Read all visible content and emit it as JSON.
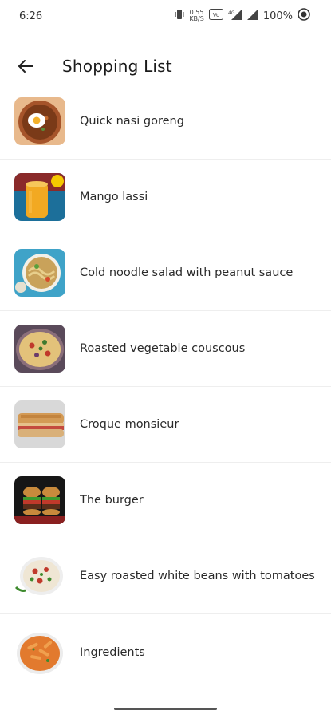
{
  "status_bar": {
    "time": "6:26",
    "net_speed_top": "0.55",
    "net_speed_bottom": "KB/S",
    "battery_percent": "100%",
    "icons": [
      "vibrate-icon",
      "network-speed-icon",
      "volte-icon",
      "signal-4g-icon",
      "signal-icon",
      "battery-icon",
      "record-icon"
    ]
  },
  "app_bar": {
    "title": "Shopping List",
    "back_icon": "arrow-left-icon"
  },
  "items": [
    {
      "label": "Quick nasi goreng"
    },
    {
      "label": "Mango lassi"
    },
    {
      "label": "Cold noodle salad with peanut sauce"
    },
    {
      "label": "Roasted vegetable couscous"
    },
    {
      "label": "Croque monsieur"
    },
    {
      "label": "The burger"
    },
    {
      "label": "Easy roasted white beans with tomatoes"
    },
    {
      "label": "Ingredients"
    }
  ],
  "colors": {
    "background": "#ffffff",
    "text": "#2a2a2a",
    "divider": "#eeeeee",
    "nav_handle": "#555555"
  }
}
